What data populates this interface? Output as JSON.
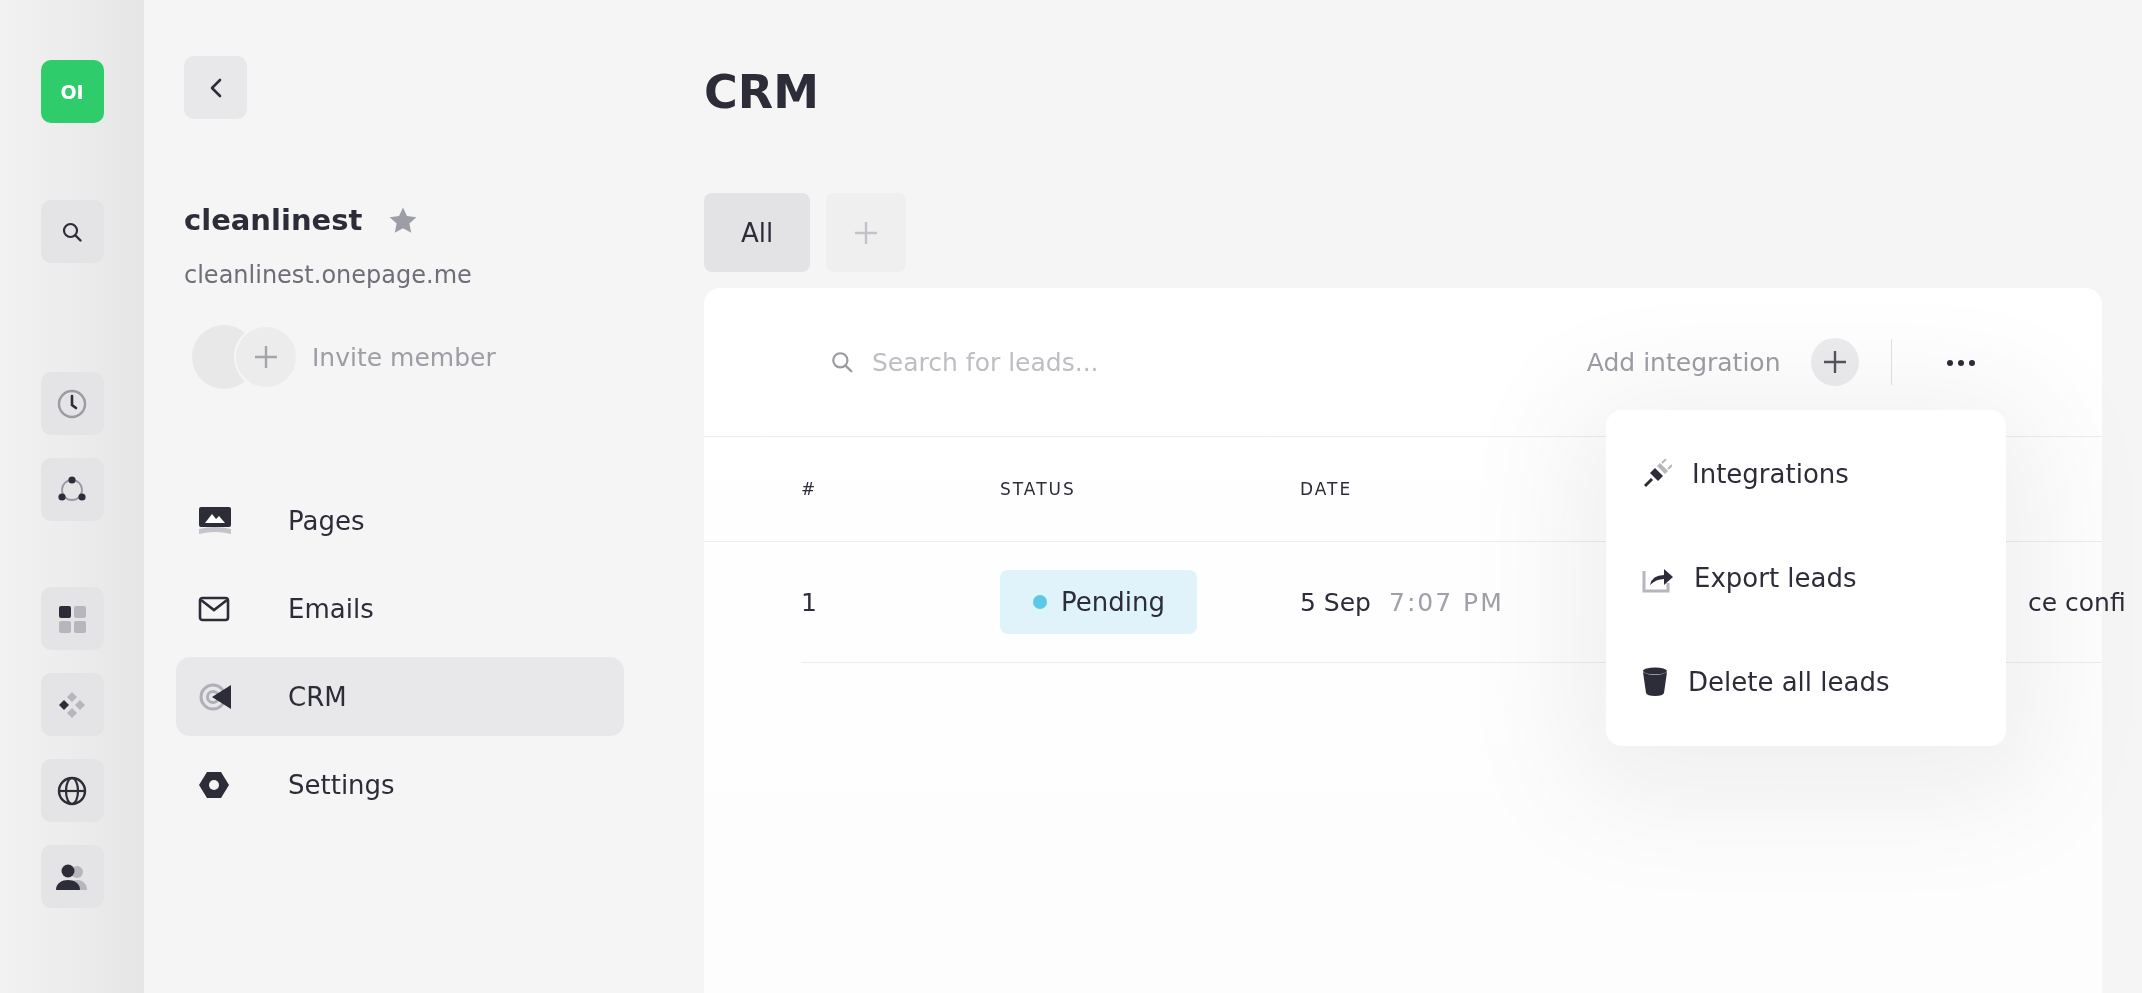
{
  "rail": {
    "logo": "OI",
    "items": [
      {
        "kind": "search"
      },
      {
        "kind": "clock"
      },
      {
        "kind": "share"
      },
      {
        "kind": "grid"
      },
      {
        "kind": "diamonds"
      },
      {
        "kind": "globe"
      },
      {
        "kind": "users"
      }
    ]
  },
  "sidebar": {
    "site_name": "cleanlinest",
    "site_url": "cleanlinest.onepage.me",
    "invite_label": "Invite member",
    "nav": [
      {
        "label": "Pages",
        "kind": "pages",
        "selected": false
      },
      {
        "label": "Emails",
        "kind": "emails",
        "selected": false
      },
      {
        "label": "CRM",
        "kind": "crm",
        "selected": true
      },
      {
        "label": "Settings",
        "kind": "settings",
        "selected": false
      }
    ]
  },
  "main": {
    "title": "CRM",
    "tabs": [
      {
        "label": "All",
        "selected": true
      }
    ],
    "search": {
      "placeholder": "Search for leads..."
    },
    "add_integration": "Add integration",
    "table": {
      "columns": [
        "#",
        "STATUS",
        "DATE"
      ],
      "rows": [
        {
          "number": "1",
          "status": {
            "label": "Pending",
            "color": "#5ac8e6"
          },
          "date": "5 Sep",
          "time": "7:07 PM",
          "column_4": "ce confi"
        }
      ]
    },
    "menu": [
      {
        "label": "Integrations",
        "kind": "plug"
      },
      {
        "label": "Export leads",
        "kind": "export"
      },
      {
        "label": "Delete all leads",
        "kind": "bin"
      }
    ]
  }
}
